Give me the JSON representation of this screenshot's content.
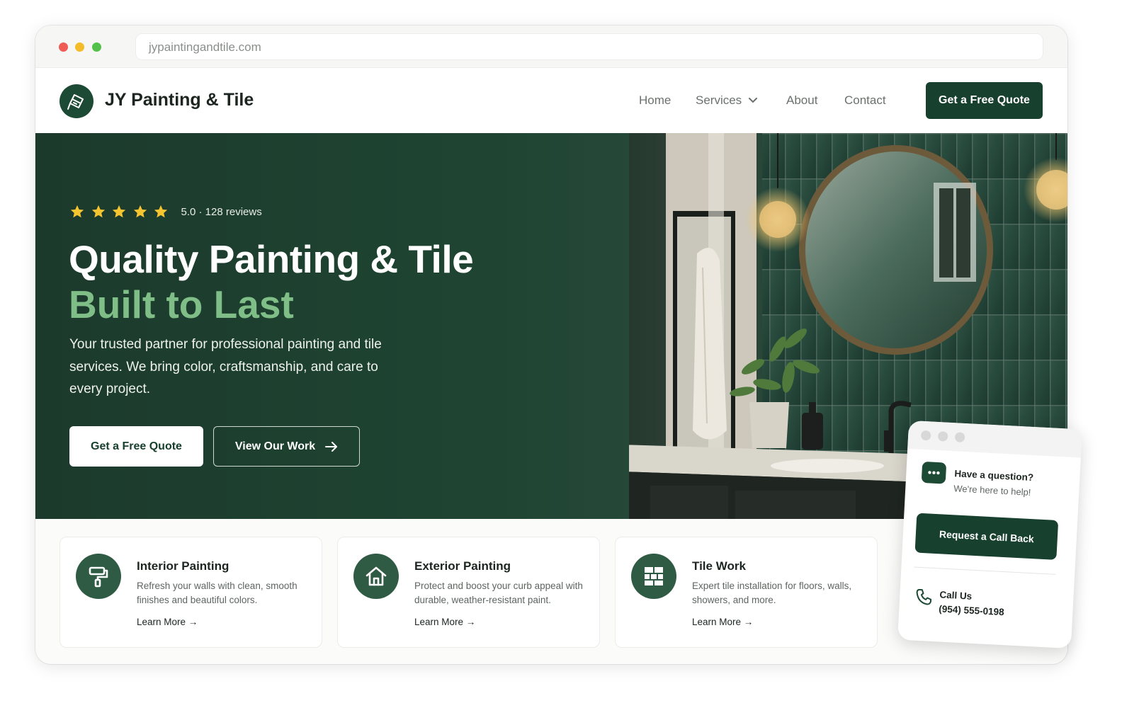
{
  "browser": {
    "url": "jypaintingandtile.com"
  },
  "header": {
    "brand": "JY Painting & Tile",
    "nav": {
      "home": "Home",
      "services": "Services",
      "about": "About",
      "contact": "Contact"
    },
    "cta": "Get a Free Quote"
  },
  "hero": {
    "rating_stars": 5,
    "rating_text": "5.0 · 128 reviews",
    "title_line1": "Quality Painting & Tile",
    "title_line2": "Built to Last",
    "lead": "Your trusted partner for professional painting and tile services. We bring color, craftsmanship, and care to every project.",
    "primary_button": "Get a Free Quote",
    "secondary_button": "View Our Work"
  },
  "services": [
    {
      "title": "Interior Painting",
      "desc": "Refresh your walls with clean, smooth finishes and beautiful colors.",
      "link": "Learn More →",
      "icon": "paint-roller-icon"
    },
    {
      "title": "Exterior Painting",
      "desc": "Protect and boost your curb appeal with durable, weather-resistant paint.",
      "link": "Learn More →",
      "icon": "house-icon"
    },
    {
      "title": "Tile Work",
      "desc": "Expert tile installation for floors, walls, showers, and more.",
      "link": "Learn More →",
      "icon": "tile-grid-icon"
    }
  ],
  "widget": {
    "question": "Have a question?",
    "subtitle": "We're here to help!",
    "button": "Request a Call Back",
    "call_label": "Call Us",
    "phone": "(954) 555-0198"
  },
  "colors": {
    "brand_green": "#17402e",
    "accent_green": "#7fbe86",
    "star": "#f5c531"
  }
}
